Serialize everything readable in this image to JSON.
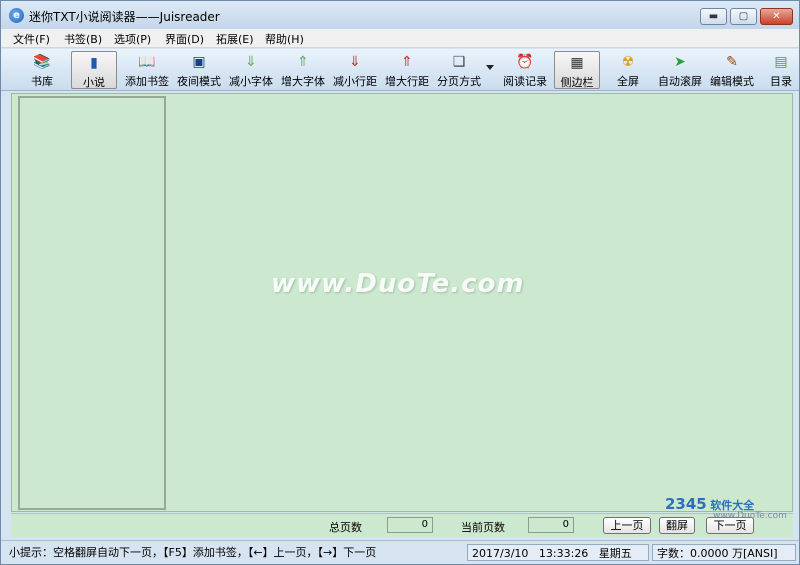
{
  "window": {
    "title": "迷你TXT小说阅读器——Juisreader",
    "app_icon_glyph": "e",
    "min_glyph": "▬",
    "max_glyph": "▢",
    "close_glyph": "✕"
  },
  "menu": [
    {
      "label": "文件(F)"
    },
    {
      "label": "书签(B)"
    },
    {
      "label": "选项(P)"
    },
    {
      "label": "界面(D)"
    },
    {
      "label": "拓展(E)"
    },
    {
      "label": "帮助(H)"
    }
  ],
  "toolbar": [
    {
      "label": "书库",
      "icon": "bookshelf-icon",
      "glyph": "📚",
      "color": "#d6337a"
    },
    {
      "label": "小说",
      "icon": "novel-book-icon",
      "glyph": "▮",
      "color": "#2358b0"
    },
    {
      "label": "添加书签",
      "icon": "add-bookmark-icon",
      "glyph": "📖",
      "color": "#333333"
    },
    {
      "label": "夜间模式",
      "icon": "night-mode-icon",
      "glyph": "▣",
      "color": "#1c3d8a"
    },
    {
      "label": "减小字体",
      "icon": "decrease-font-icon",
      "glyph": "⇓",
      "color": "#6aa84f"
    },
    {
      "label": "增大字体",
      "icon": "increase-font-icon",
      "glyph": "⇑",
      "color": "#6aa84f"
    },
    {
      "label": "减小行距",
      "icon": "decrease-line-spacing-icon",
      "glyph": "⇓",
      "color": "#d03030"
    },
    {
      "label": "增大行距",
      "icon": "increase-line-spacing-icon",
      "glyph": "⇑",
      "color": "#d03030"
    },
    {
      "label": "分页方式",
      "icon": "page-mode-icon",
      "glyph": "❑",
      "color": "#444444"
    },
    {
      "label": "阅读记录",
      "icon": "reading-history-clock-icon",
      "glyph": "⏰",
      "color": "#333333"
    },
    {
      "label": "侧边栏",
      "icon": "sidebar-icon",
      "glyph": "▦",
      "color": "#333333"
    },
    {
      "label": "全屏",
      "icon": "fullscreen-icon",
      "glyph": "☢",
      "color": "#d4a017"
    },
    {
      "label": "自动滚屏",
      "icon": "auto-scroll-icon",
      "glyph": "➤",
      "color": "#2e9e3a"
    },
    {
      "label": "编辑模式",
      "icon": "edit-mode-pen-icon",
      "glyph": "✎",
      "color": "#8a4b1c"
    },
    {
      "label": "目录",
      "icon": "contents-icon",
      "glyph": "▤",
      "color": "#6b8f4a"
    }
  ],
  "watermark": "www.DuoTe.com",
  "pagebar": {
    "total_pages_label": "总页数",
    "total_pages_value": "0",
    "current_page_label": "当前页数",
    "current_page_value": "0",
    "prev_label": "上一页",
    "flip_label": "翻屏",
    "next_label": "下一页"
  },
  "status": {
    "tip": "小提示：空格翻屏自动下一页，【F5】添加书签，【←】上一页，【→】下一页",
    "date": "2017/3/10",
    "time": "13:33:26",
    "weekday": "星期五",
    "word_count": "字数：0.0000 万[ANSI]"
  },
  "brand": {
    "number": "2345",
    "name": "软件大全",
    "url": "www.DuoTe.com"
  }
}
